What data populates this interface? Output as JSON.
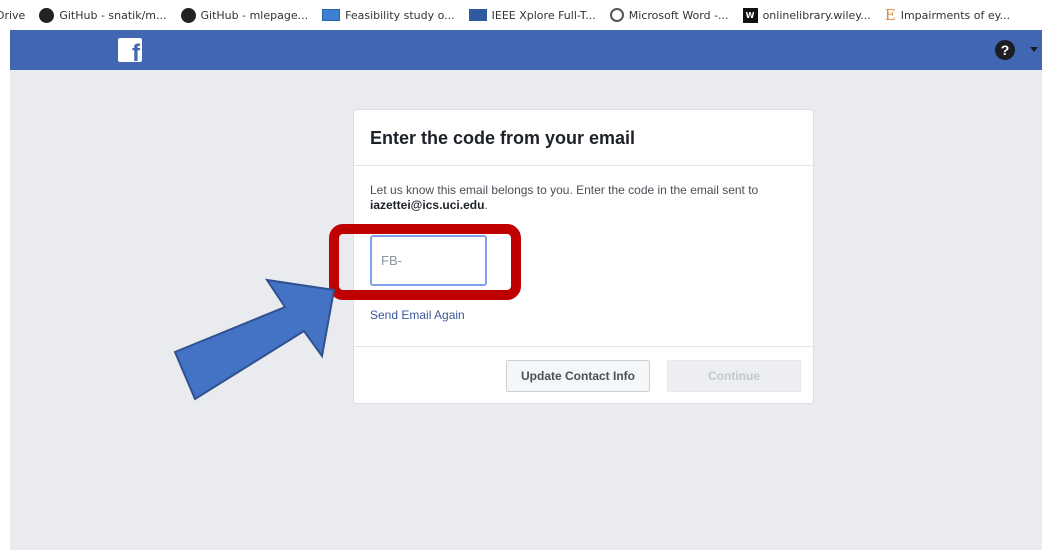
{
  "bookmarks": [
    {
      "label": "Drive",
      "icon": "drive-icon"
    },
    {
      "label": "GitHub - snatik/m...",
      "icon": "github-icon"
    },
    {
      "label": "GitHub - mlepage...",
      "icon": "github-icon"
    },
    {
      "label": "Feasibility study o...",
      "icon": "feasibility-icon"
    },
    {
      "label": "IEEE Xplore Full-T...",
      "icon": "ieee-icon"
    },
    {
      "label": "Microsoft Word -...",
      "icon": "word-icon"
    },
    {
      "label": "onlinelibrary.wiley...",
      "icon": "wiley-icon",
      "badge": "W"
    },
    {
      "label": "Impairments of ey...",
      "icon": "impairments-icon",
      "badge": "E"
    }
  ],
  "header": {
    "logo": "f",
    "help": "?"
  },
  "dialog": {
    "title": "Enter the code from your email",
    "description_prefix": "Let us know this email belongs to you. Enter the code in the email sent to ",
    "email": "iazettei@ics.uci.edu",
    "description_suffix": ".",
    "code_input_placeholder": "FB-",
    "code_input_value": "",
    "send_again_label": "Send Email Again",
    "update_button_label": "Update Contact Info",
    "continue_button_label": "Continue"
  },
  "colors": {
    "facebook_blue": "#4267b2",
    "page_background": "#e9ebee",
    "annotation_red": "#c00000",
    "annotation_arrow": "#4472c4",
    "link": "#385898"
  }
}
